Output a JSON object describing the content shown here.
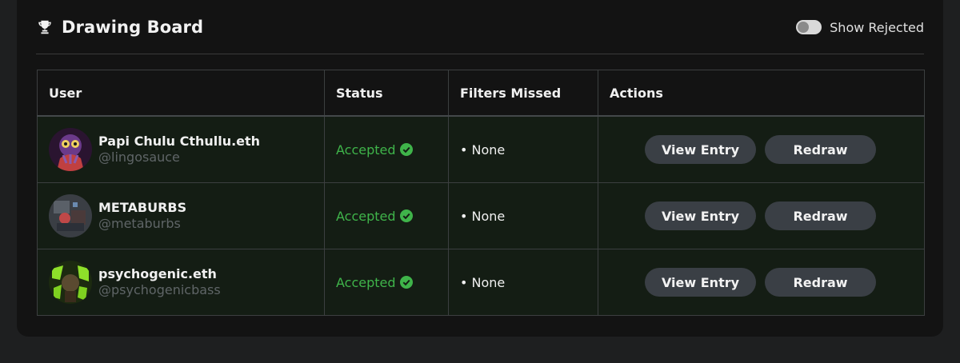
{
  "header": {
    "title": "Drawing Board",
    "toggle_label": "Show Rejected",
    "toggle_on": false
  },
  "table": {
    "columns": [
      "User",
      "Status",
      "Filters Missed",
      "Actions"
    ],
    "rows": [
      {
        "display_name": "Papi Chulu Cthullu.eth",
        "handle": "@lingosauce",
        "status": "Accepted",
        "filters_missed": "• None",
        "view_label": "View Entry",
        "redraw_label": "Redraw"
      },
      {
        "display_name": "METABURBS",
        "handle": "@metaburbs",
        "status": "Accepted",
        "filters_missed": "• None",
        "view_label": "View Entry",
        "redraw_label": "Redraw"
      },
      {
        "display_name": "psychogenic.eth",
        "handle": "@psychogenicbass",
        "status": "Accepted",
        "filters_missed": "• None",
        "view_label": "View Entry",
        "redraw_label": "Redraw"
      }
    ]
  },
  "colors": {
    "accepted": "#3fb44a",
    "button_bg": "#3a3f45",
    "row_bg": "#141d14"
  },
  "icons": {
    "title_icon": "trophy-icon",
    "status_icon": "check-circle-icon"
  }
}
